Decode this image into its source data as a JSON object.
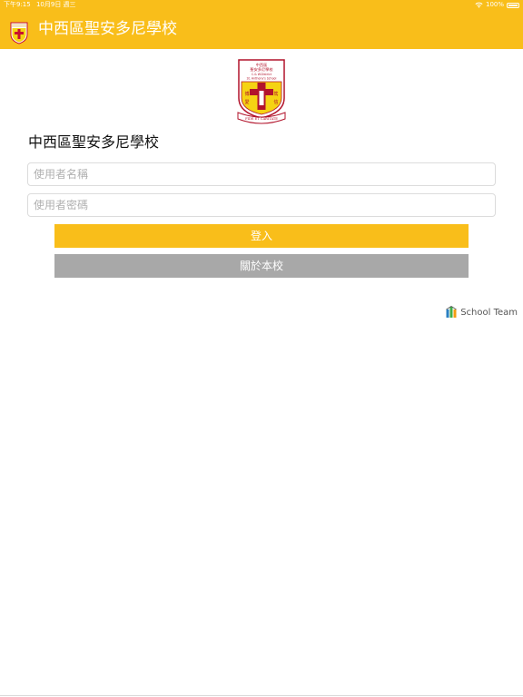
{
  "status_bar": {
    "time": "下午9:15",
    "date": "10月9日 週三",
    "battery": "100%"
  },
  "nav": {
    "title": "中西區聖安多尼學校"
  },
  "logo": {
    "line1": "中西區",
    "line2": "聖安多尼學校",
    "line3": "C.& W.District",
    "line4": "St. Anthony's School",
    "motto": "FIDE ET CARITATE",
    "char_left_top": "博",
    "char_left_bottom": "愛",
    "char_right_top": "篤",
    "char_right_bottom": "信"
  },
  "login": {
    "school_name": "中西區聖安多尼學校",
    "username_placeholder": "使用者名稱",
    "password_placeholder": "使用者密碼",
    "login_label": "登入",
    "about_label": "關於本校"
  },
  "brand": {
    "text": "School Team"
  },
  "colors": {
    "accent": "#f9be1a",
    "secondary_button": "#a8a8a8"
  }
}
